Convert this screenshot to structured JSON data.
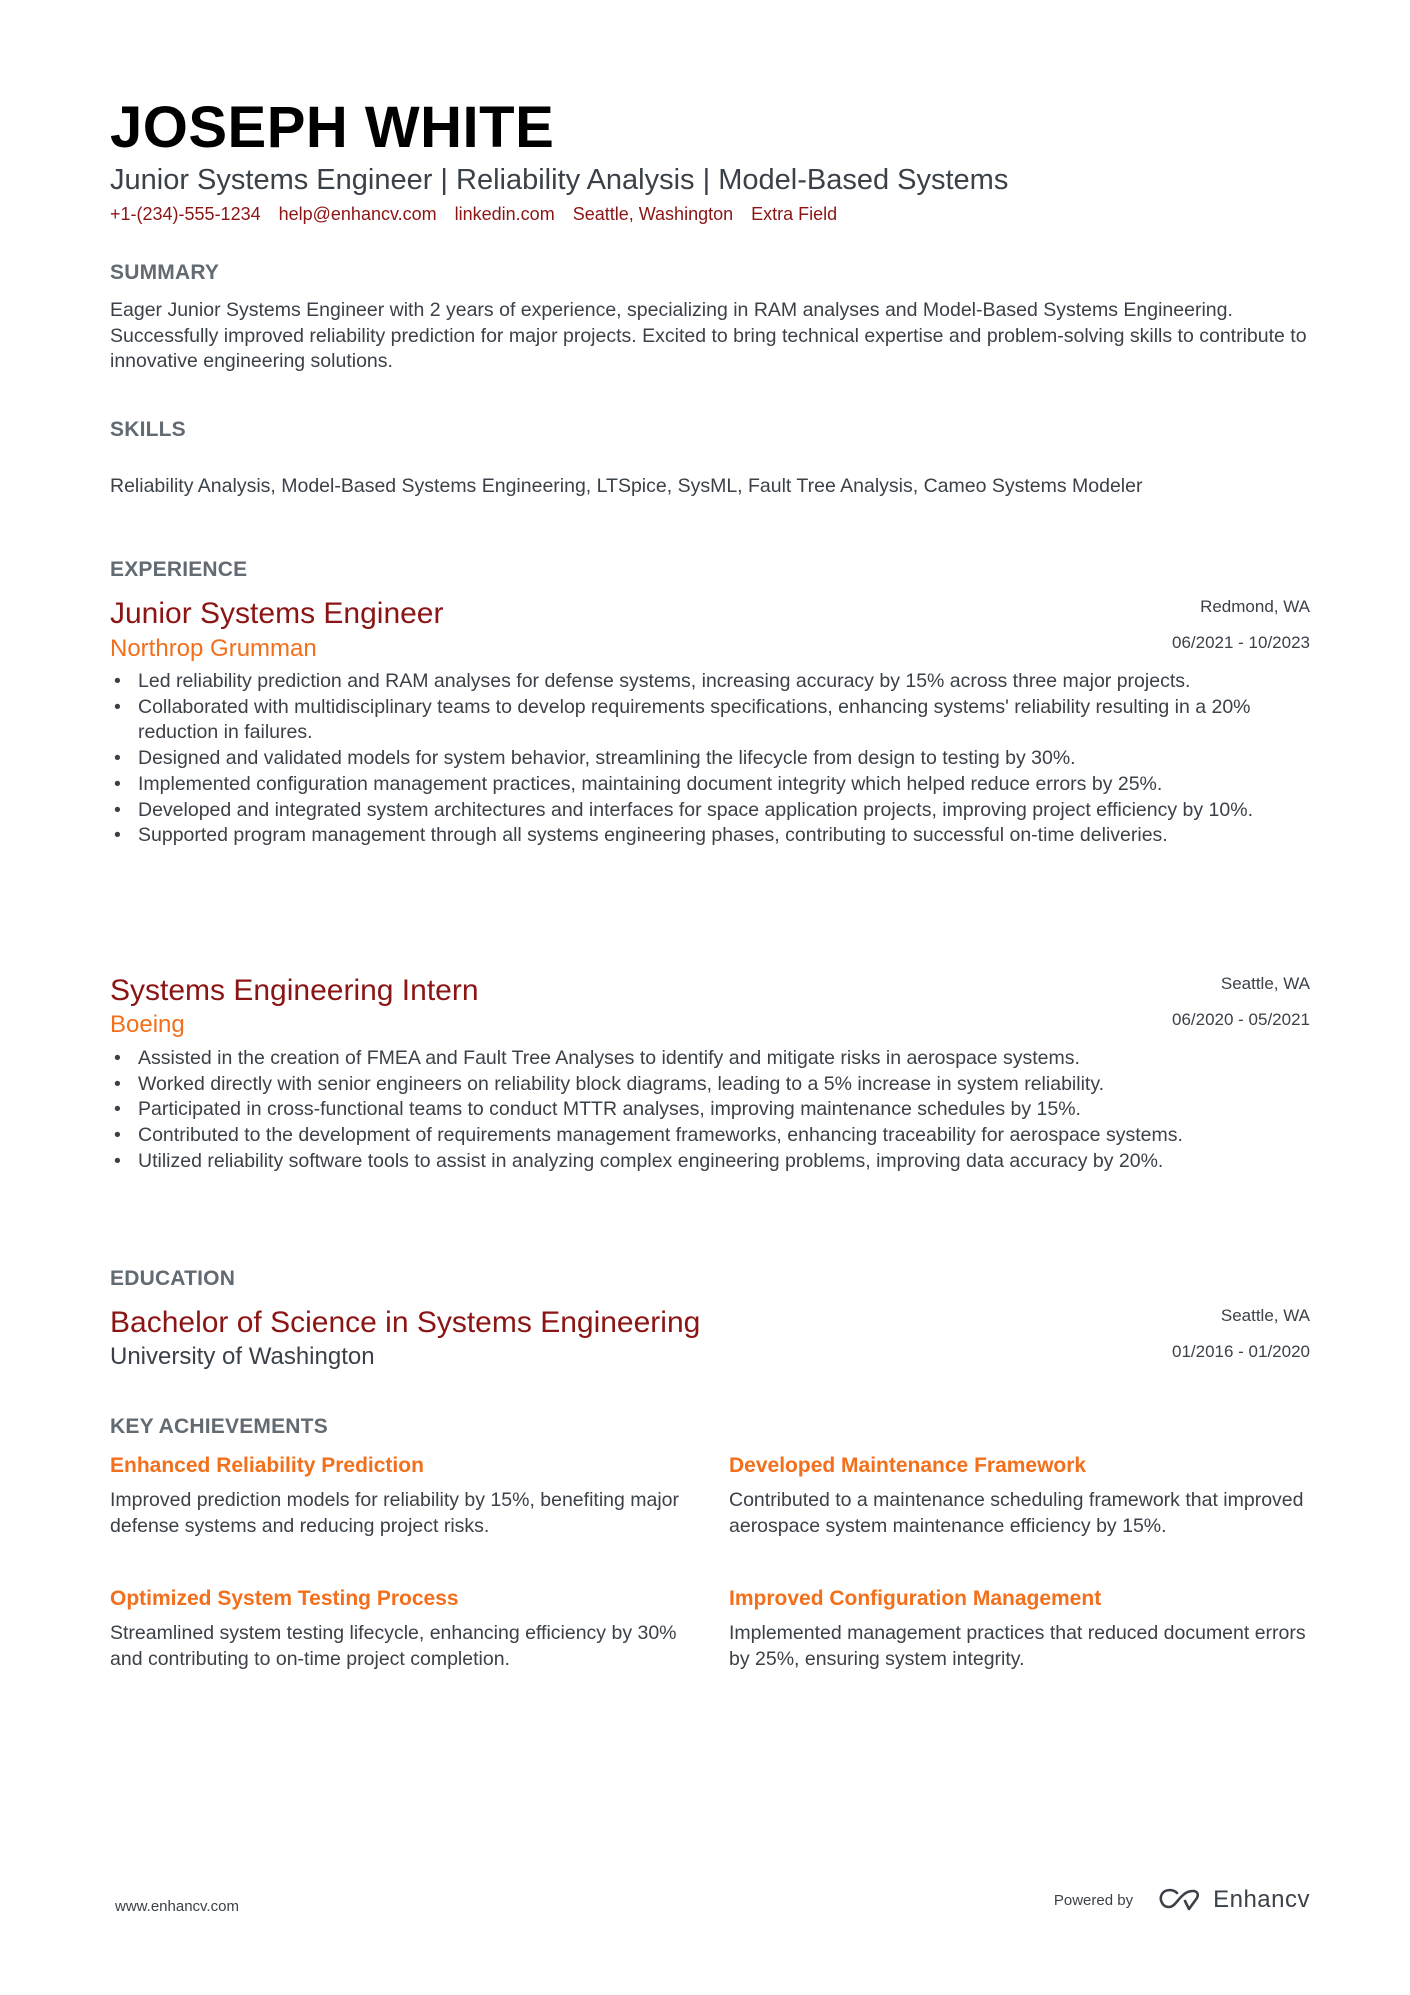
{
  "header": {
    "name": "JOSEPH WHITE",
    "subtitle": "Junior Systems Engineer | Reliability Analysis | Model-Based Systems",
    "contact": [
      "+1-(234)-555-1234",
      "help@enhancv.com",
      "linkedin.com",
      "Seattle, Washington",
      "Extra Field"
    ]
  },
  "summary": {
    "heading": "SUMMARY",
    "text": "Eager Junior Systems Engineer with 2 years of experience, specializing in RAM analyses and Model-Based Systems Engineering. Successfully improved reliability prediction for major projects. Excited to bring technical expertise and problem-solving skills to contribute to innovative engineering solutions."
  },
  "skills": {
    "heading": "SKILLS",
    "text": "Reliability Analysis, Model-Based Systems Engineering, LTSpice, SysML, Fault Tree Analysis, Cameo Systems Modeler"
  },
  "experience": {
    "heading": "EXPERIENCE",
    "jobs": [
      {
        "title": "Junior Systems Engineer",
        "company": "Northrop Grumman",
        "location": "Redmond, WA",
        "dates": "06/2021 - 10/2023",
        "bullets": [
          "Led reliability prediction and RAM analyses for defense systems, increasing accuracy by 15% across three major projects.",
          "Collaborated with multidisciplinary teams to develop requirements specifications, enhancing systems' reliability resulting in a 20% reduction in failures.",
          "Designed and validated models for system behavior, streamlining the lifecycle from design to testing by 30%.",
          "Implemented configuration management practices, maintaining document integrity which helped reduce errors by 25%.",
          "Developed and integrated system architectures and interfaces for space application projects, improving project efficiency by 10%.",
          "Supported program management through all systems engineering phases, contributing to successful on-time deliveries."
        ]
      },
      {
        "title": "Systems Engineering Intern",
        "company": "Boeing",
        "location": "Seattle, WA",
        "dates": "06/2020 - 05/2021",
        "bullets": [
          "Assisted in the creation of FMEA and Fault Tree Analyses to identify and mitigate risks in aerospace systems.",
          "Worked directly with senior engineers on reliability block diagrams, leading to a 5% increase in system reliability.",
          "Participated in cross-functional teams to conduct MTTR analyses, improving maintenance schedules by 15%.",
          "Contributed to the development of requirements management frameworks, enhancing traceability for aerospace systems.",
          "Utilized reliability software tools to assist in analyzing complex engineering problems, improving data accuracy by 20%."
        ]
      }
    ]
  },
  "education": {
    "heading": "EDUCATION",
    "degree": "Bachelor of Science in Systems Engineering",
    "school": "University of Washington",
    "location": "Seattle, WA",
    "dates": "01/2016 - 01/2020"
  },
  "achievements": {
    "heading": "KEY ACHIEVEMENTS",
    "items": [
      {
        "title": "Enhanced Reliability Prediction",
        "desc": "Improved prediction models for reliability by 15%, benefiting major defense systems and reducing project risks."
      },
      {
        "title": "Developed Maintenance Framework",
        "desc": "Contributed to a maintenance scheduling framework that improved aerospace system maintenance efficiency by 15%."
      },
      {
        "title": "Optimized System Testing Process",
        "desc": "Streamlined system testing lifecycle, enhancing efficiency by 30% and contributing to on-time project completion."
      },
      {
        "title": "Improved Configuration Management",
        "desc": "Implemented management practices that reduced document errors by 25%, ensuring system integrity."
      }
    ]
  },
  "footer": {
    "website": "www.enhancv.com",
    "powered_by": "Powered by",
    "brand": "Enhancv",
    "brand_icon": "enhancv-logo-icon"
  },
  "colors": {
    "name": "#000000",
    "accent_red": "#8b1414",
    "accent_orange": "#f26f1b",
    "section_heading": "#626a72",
    "body_text": "#3b4148"
  }
}
